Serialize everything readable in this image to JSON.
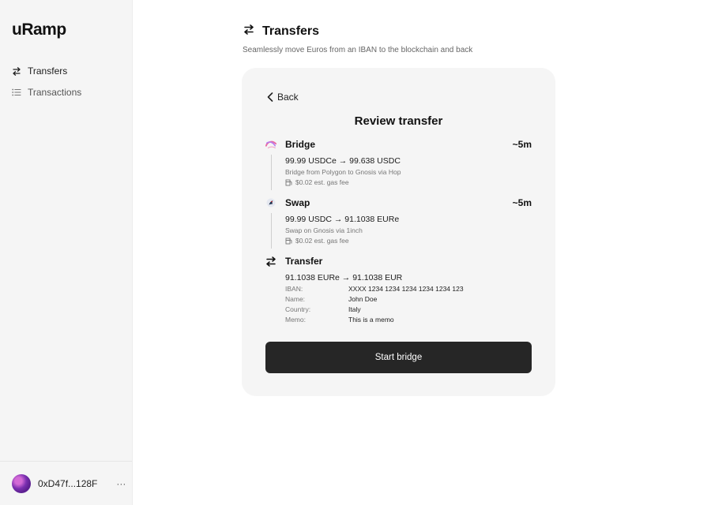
{
  "app": {
    "brand": "uRamp"
  },
  "sidebar": {
    "items": [
      {
        "label": "Transfers",
        "icon": "transfer-arrows-icon",
        "active": true
      },
      {
        "label": "Transactions",
        "icon": "list-icon",
        "active": false
      }
    ],
    "account": {
      "address": "0xD47f...128F",
      "more": "···"
    }
  },
  "header": {
    "title": "Transfers",
    "subtitle": "Seamlessly move Euros from an IBAN to the blockchain and back"
  },
  "review": {
    "back_label": "Back",
    "title": "Review transfer",
    "steps": [
      {
        "name": "Bridge",
        "time": "~5m",
        "icon": "hop-bridge-icon",
        "amount": "99.99 USDCe → 99.638 USDC",
        "detail": "Bridge from Polygon to Gnosis via Hop",
        "fee": "$0.02 est. gas fee"
      },
      {
        "name": "Swap",
        "time": "~5m",
        "icon": "1inch-icon",
        "amount": "99.99 USDC → 91.1038 EURe",
        "detail": "Swap on Gnosis via 1inch",
        "fee": "$0.02 est. gas fee"
      },
      {
        "name": "Transfer",
        "icon": "transfer-arrows-icon",
        "amount": "91.1038 EURe → 91.1038 EUR",
        "fields": [
          {
            "label": "IBAN:",
            "value": "XXXX 1234 1234 1234 1234 1234 123"
          },
          {
            "label": "Name:",
            "value": "John Doe"
          },
          {
            "label": "Country:",
            "value": "Italy"
          },
          {
            "label": "Memo:",
            "value": "This is a memo"
          }
        ]
      }
    ],
    "start_button": "Start bridge"
  },
  "colors": {
    "sidebar_bg": "#f5f5f5",
    "card_bg": "#f5f5f5",
    "button_bg": "#262626",
    "text": "#1c1c1c"
  }
}
